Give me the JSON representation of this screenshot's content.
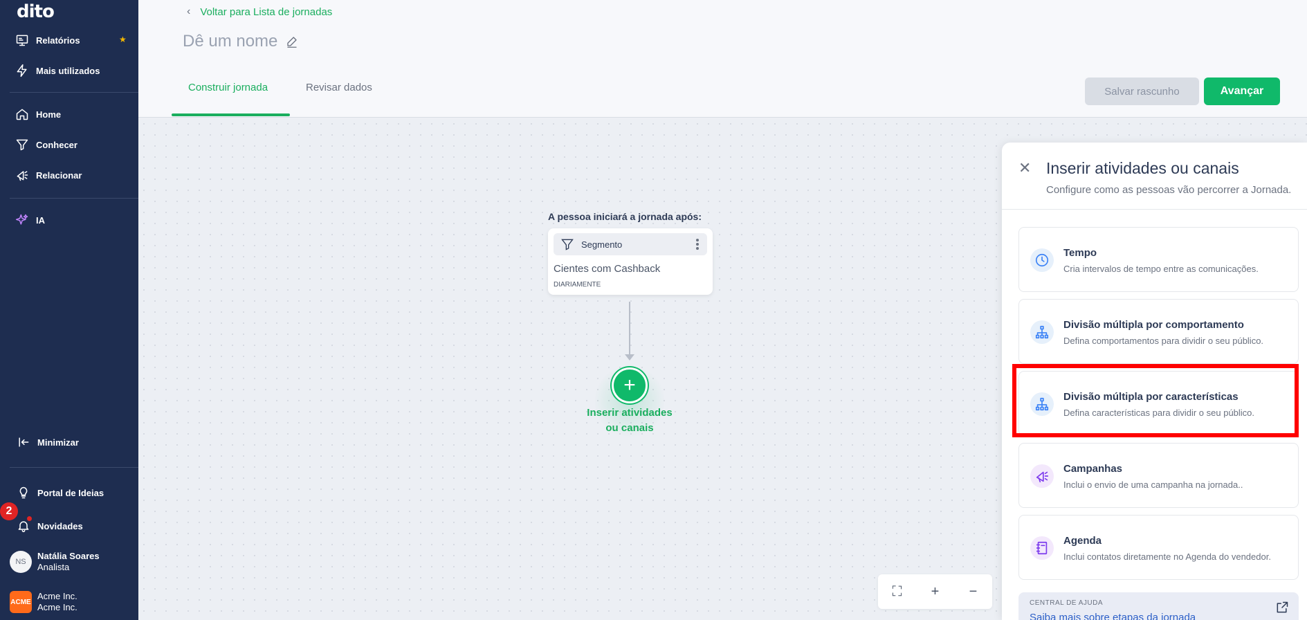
{
  "sidebar": {
    "logo": "dito",
    "items": [
      {
        "label": "Relatórios"
      },
      {
        "label": "Mais utilizados"
      },
      {
        "label": "Home"
      },
      {
        "label": "Conhecer"
      },
      {
        "label": "Relacionar"
      },
      {
        "label": "IA"
      },
      {
        "label": "Minimizar"
      },
      {
        "label": "Portal de Ideias"
      },
      {
        "label": "Novidades"
      }
    ],
    "badge_count": "2",
    "user": {
      "initials": "NS",
      "name": "Natália Soares",
      "role": "Analista"
    },
    "org": {
      "logo": "ACME",
      "name": "Acme Inc.",
      "sub": "Acme Inc."
    }
  },
  "header": {
    "back_label": "Voltar para Lista de jornadas",
    "title": "Dê um nome",
    "tabs": [
      {
        "label": "Construir jornada"
      },
      {
        "label": "Revisar dados"
      }
    ],
    "save_draft": "Salvar rascunho",
    "next": "Avançar"
  },
  "canvas": {
    "start_label": "A pessoa iniciará a jornada após:",
    "segment": {
      "type": "Segmento",
      "name": "Cientes com Cashback",
      "frequency": "DIARIAMENTE"
    },
    "add_label_line1": "Inserir atividades",
    "add_label_line2": "ou canais"
  },
  "panel": {
    "title": "Inserir atividades ou canais",
    "subtitle": "Configure como as pessoas vão percorrer a Jornada.",
    "options": [
      {
        "title": "Tempo",
        "desc": "Cria intervalos de tempo entre as comunicações.",
        "icon": "clock-icon"
      },
      {
        "title": "Divisão múltipla por comportamento",
        "desc": "Defina comportamentos para dividir o seu público.",
        "icon": "split-icon"
      },
      {
        "title": "Divisão múltipla por características",
        "desc": "Defina características para dividir o seu público.",
        "icon": "split-icon"
      },
      {
        "title": "Campanhas",
        "desc": "Inclui o envio de uma campanha na jornada..",
        "icon": "megaphone-icon"
      },
      {
        "title": "Agenda",
        "desc": "Inclui contatos diretamente no Agenda do vendedor.",
        "icon": "notebook-icon"
      }
    ],
    "help_label": "CENTRAL DE AJUDA",
    "help_link": "Saiba mais sobre etapas da jornada"
  },
  "colors": {
    "sidebar_bg": "#1e2d50",
    "accent_green": "#10b96a",
    "highlight": "#ff0000"
  }
}
